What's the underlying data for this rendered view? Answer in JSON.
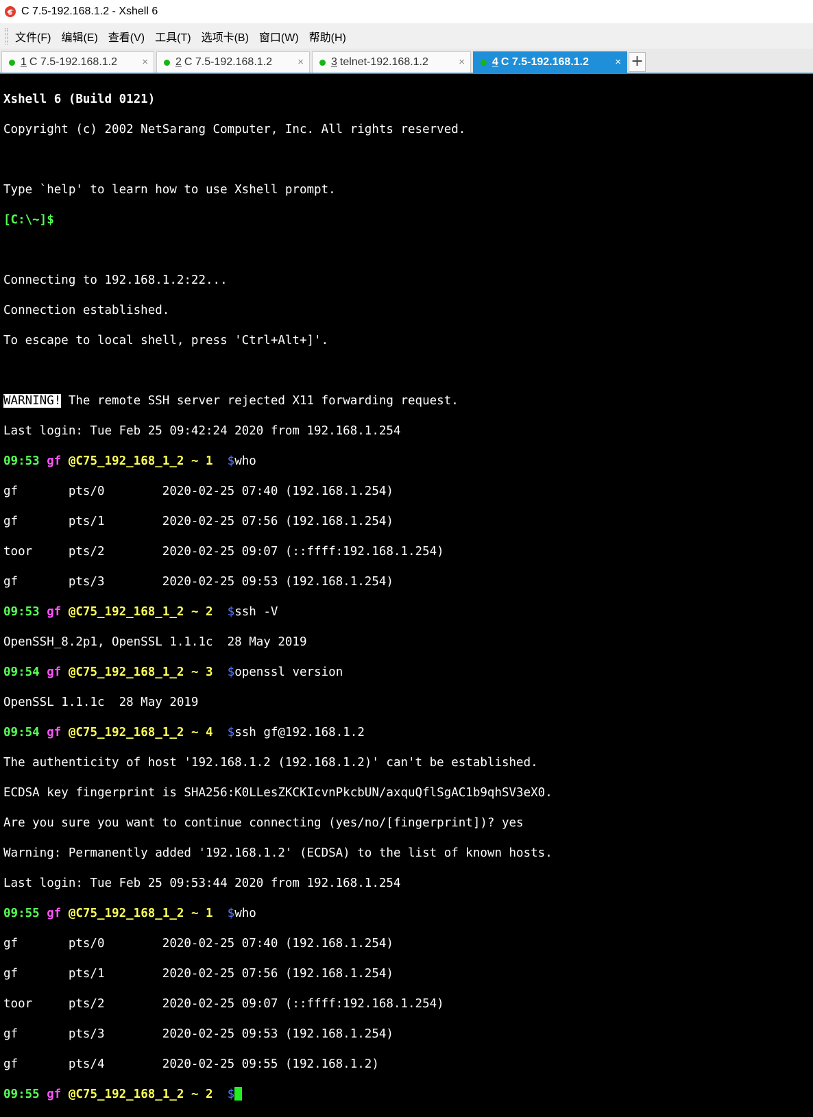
{
  "window": {
    "title": "C 7.5-192.168.1.2 - Xshell 6"
  },
  "menu": [
    "文件(F)",
    "编辑(E)",
    "查看(V)",
    "工具(T)",
    "选项卡(B)",
    "窗口(W)",
    "帮助(H)"
  ],
  "tabs": [
    {
      "num": "1",
      "label": "C 7.5-192.168.1.2",
      "status": "connected"
    },
    {
      "num": "2",
      "label": "C 7.5-192.168.1.2",
      "status": "connected"
    },
    {
      "num": "3",
      "label": "telnet-192.168.1.2",
      "status": "connected"
    },
    {
      "num": "4",
      "label": "C 7.5-192.168.1.2",
      "status": "connected",
      "active": true
    }
  ],
  "tab_close_glyph": "×",
  "new_tab_glyph": "+",
  "colors": {
    "accent": "#1e8fd8",
    "connected_dot": "#17b517",
    "prompt_time": "#55ff55",
    "prompt_user": "#ff55ff",
    "prompt_host": "#ffff55",
    "prompt_dollar": "#5577ff",
    "cursor": "#22ee22"
  },
  "icons": {
    "app": "xshell-logo-icon"
  },
  "terminal": {
    "header": {
      "banner": "Xshell 6 (Build 0121)",
      "copyright": "Copyright (c) 2002 NetSarang Computer, Inc. All rights reserved.",
      "help": "Type `help' to learn how to use Xshell prompt.",
      "local_prompt": "[C:\\~]$",
      "connecting": "Connecting to 192.168.1.2:22...",
      "established": "Connection established.",
      "escape": "To escape to local shell, press 'Ctrl+Alt+]'.",
      "warning_tag": "WARNING!",
      "warning_text": " The remote SSH server rejected X11 forwarding request.",
      "last_login_1": "Last login: Tue Feb 25 09:42:24 2020 from 192.168.1.254"
    },
    "p1": {
      "time": "09:53",
      "user": "gf",
      "host": "@C75_192_168_1_2 ~ 1",
      "cmd": "who"
    },
    "who1": [
      "gf       pts/0        2020-02-25 07:40 (192.168.1.254)",
      "gf       pts/1        2020-02-25 07:56 (192.168.1.254)",
      "toor     pts/2        2020-02-25 09:07 (::ffff:192.168.1.254)",
      "gf       pts/3        2020-02-25 09:53 (192.168.1.254)"
    ],
    "p2": {
      "time": "09:53",
      "user": "gf",
      "host": "@C75_192_168_1_2 ~ 2",
      "cmd": "ssh -V"
    },
    "ssh_version": "OpenSSH_8.2p1, OpenSSL 1.1.1c  28 May 2019",
    "p3": {
      "time": "09:54",
      "user": "gf",
      "host": "@C75_192_168_1_2 ~ 3",
      "cmd": "openssl version"
    },
    "openssl_version": "OpenSSL 1.1.1c  28 May 2019",
    "p4": {
      "time": "09:54",
      "user": "gf",
      "host": "@C75_192_168_1_2 ~ 4",
      "cmd": "ssh gf@192.168.1.2"
    },
    "ssh_output": [
      "The authenticity of host '192.168.1.2 (192.168.1.2)' can't be established.",
      "ECDSA key fingerprint is SHA256:K0LLesZKCKIcvnPkcbUN/axquQflSgAC1b9qhSV3eX0.",
      "Are you sure you want to continue connecting (yes/no/[fingerprint])? yes",
      "Warning: Permanently added '192.168.1.2' (ECDSA) to the list of known hosts.",
      "Last login: Tue Feb 25 09:53:44 2020 from 192.168.1.254"
    ],
    "p5": {
      "time": "09:55",
      "user": "gf",
      "host": "@C75_192_168_1_2 ~ 1",
      "cmd": "who"
    },
    "who2": [
      "gf       pts/0        2020-02-25 07:40 (192.168.1.254)",
      "gf       pts/1        2020-02-25 07:56 (192.168.1.254)",
      "toor     pts/2        2020-02-25 09:07 (::ffff:192.168.1.254)",
      "gf       pts/3        2020-02-25 09:53 (192.168.1.254)",
      "gf       pts/4        2020-02-25 09:55 (192.168.1.2)"
    ],
    "p6": {
      "time": "09:55",
      "user": "gf",
      "host": "@C75_192_168_1_2 ~ 2",
      "cmd": ""
    },
    "dollar": "$"
  }
}
